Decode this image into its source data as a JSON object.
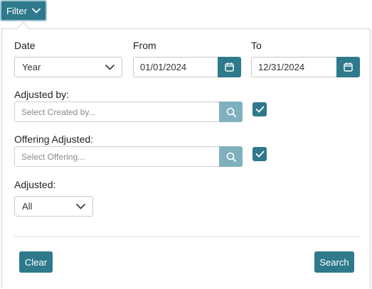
{
  "header": {
    "filter_label": "Filter",
    "filter_icon": "chevron-down-icon"
  },
  "date": {
    "label": "Date",
    "selected": "Year",
    "from_label": "From",
    "from_value": "01/01/2024",
    "to_label": "To",
    "to_value": "12/31/2024",
    "calendar_icon": "calendar-icon"
  },
  "adjusted_by": {
    "label": "Adjusted by:",
    "placeholder": "Select Created by...",
    "search_icon": "search-icon",
    "checked": true
  },
  "offering_adjusted": {
    "label": "Offering Adjusted:",
    "placeholder": "Select Offering...",
    "search_icon": "search-icon",
    "checked": true
  },
  "adjusted": {
    "label": "Adjusted:",
    "selected": "All"
  },
  "footer": {
    "clear_label": "Clear",
    "search_label": "Search"
  },
  "colors": {
    "primary": "#2e7a8c",
    "search_button": "#7fb0bd",
    "border": "#c8c8c8",
    "placeholder": "#8a8a8a"
  }
}
